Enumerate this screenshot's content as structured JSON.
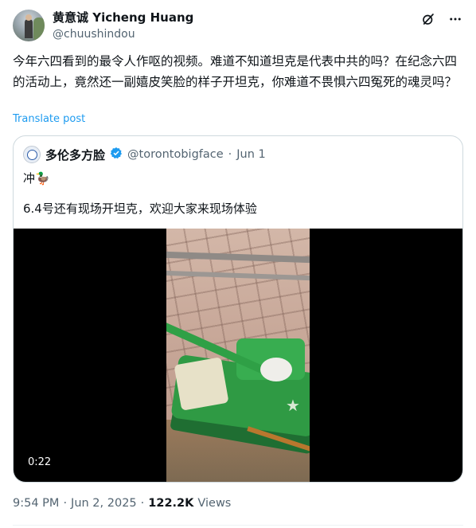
{
  "author": {
    "display_name": "黄意诚 Yicheng Huang",
    "handle": "@chuushindou"
  },
  "header_icons": [
    "grok-icon",
    "more-icon"
  ],
  "tweet": {
    "text": "今年六四看到的最令人作呕的视频。难道不知道坦克是代表中共的吗？在纪念六四的活动上，竟然还一副嬉皮笑脸的样子开坦克，你难道不畏惧六四冤死的魂灵吗？",
    "translate_label": "Translate post"
  },
  "quote": {
    "display_name": "多伦多方脸",
    "verified": true,
    "handle": "@torontobigface",
    "separator": "·",
    "date": "Jun 1",
    "text_line1": "冲🦆",
    "text_line2": "6.4号还有现场开坦克，欢迎大家来现场体验",
    "video_duration": "0:22"
  },
  "footer": {
    "time": "9:54 PM",
    "dot1": "·",
    "date": "Jun 2, 2025",
    "dot2": "·",
    "views_count": "122.2K",
    "views_label": "Views"
  },
  "colors": {
    "link": "#1d9bf0",
    "muted": "#536471",
    "verified": "#1d9bf0",
    "border": "#cfd9de"
  }
}
